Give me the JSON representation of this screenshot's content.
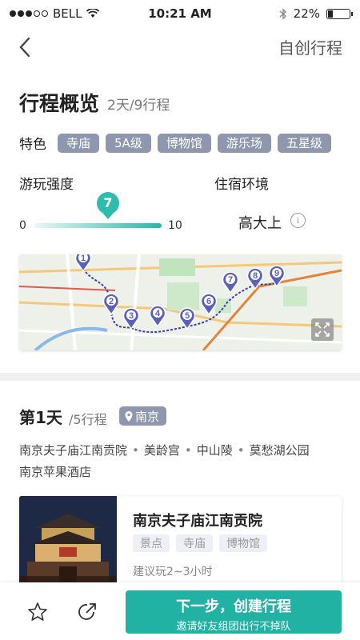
{
  "status_bar": {
    "carrier": "BELL",
    "time": "10:21 AM",
    "battery": "22%",
    "battery_level": 0.22,
    "signal_bars_filled": 3,
    "signal_bars_total": 5
  },
  "nav": {
    "back_icon": "chevron-left-icon",
    "title": "自创行程"
  },
  "overview": {
    "title": "行程概览",
    "subtitle": "2天/9行程",
    "features_label": "特色",
    "features": [
      "寺庙",
      "5A级",
      "博物馆",
      "游乐场",
      "五星级"
    ]
  },
  "intensity": {
    "label": "游玩强度",
    "min": "0",
    "max": "10",
    "value": "7"
  },
  "lodging": {
    "label": "住宿环境",
    "value": "高大上",
    "info_icon": "info-icon"
  },
  "map": {
    "markers": [
      "1",
      "2",
      "3",
      "4",
      "5",
      "6",
      "7",
      "8",
      "9"
    ],
    "expand_icon": "expand-icon",
    "route_color": "#3c3fa8",
    "marker_color": "#5a61b8"
  },
  "day": {
    "title": "第1天",
    "subtitle": "/5行程",
    "city": "南京",
    "route_line1": [
      "南京夫子庙江南贡院",
      "美龄宫",
      "中山陵",
      "莫愁湖公园"
    ],
    "route_line2": "南京苹果酒店"
  },
  "card": {
    "title": "南京夫子庙江南贡院",
    "tags": [
      "景点",
      "寺庙",
      "博物馆"
    ],
    "duration": "建议玩2~3小时"
  },
  "bottom": {
    "star_icon": "star-icon",
    "share_icon": "share-icon",
    "cta_main": "下一步，创建行程",
    "cta_sub": "邀请好友组团出行不掉队",
    "accent": "#22b2a4"
  }
}
